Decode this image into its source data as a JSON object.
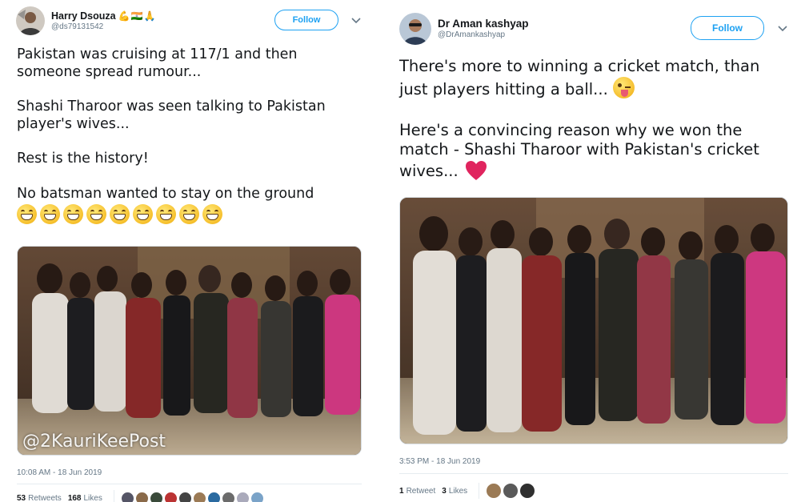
{
  "tweets": [
    {
      "author": {
        "name": "Harry Dsouza",
        "name_emojis": "💪🇮🇳🙏",
        "handle": "@ds79131542"
      },
      "follow_label": "Follow",
      "text": {
        "line1": "Pakistan was cruising at 117/1 and then",
        "line2": "someone spread rumour...",
        "line3": "Shashi Tharoor was seen talking to Pakistan",
        "line4": "player's wives...",
        "line5": "Rest is the history!",
        "line6": "No batsman wanted to stay on the ground",
        "emoji": "grinning-face-with-smiling-eyes",
        "emoji_count": 9
      },
      "media": {
        "watermark": "@2KauriKeePost"
      },
      "timestamp": "10:08 AM - 18 Jun 2019",
      "stats": {
        "retweets_count": "53",
        "retweets_label": "Retweets",
        "likes_count": "168",
        "likes_label": "Likes",
        "liker_avatars_shown": 10
      }
    },
    {
      "author": {
        "name": "Dr Aman kashyap",
        "handle": "@DrAmankashyap"
      },
      "follow_label": "Follow",
      "text": {
        "line1": "There's more to winning a cricket match, than",
        "line2": "just players hitting a ball...",
        "line2_emoji": "winking-face-with-tongue",
        "line3": "Here's a convincing reason why we won the",
        "line4": "match - Shashi Tharoor with Pakistan's cricket",
        "line5": "wives...",
        "line5_emoji": "red-heart"
      },
      "timestamp": "3:53 PM - 18 Jun 2019",
      "stats": {
        "retweets_count": "1",
        "retweets_label": "Retweet",
        "likes_count": "3",
        "likes_label": "Likes",
        "liker_avatars_shown": 3
      }
    }
  ],
  "colors": {
    "accent": "#1da1f2",
    "text": "#14171a",
    "muted": "#657786",
    "heart": "#e0245e"
  }
}
